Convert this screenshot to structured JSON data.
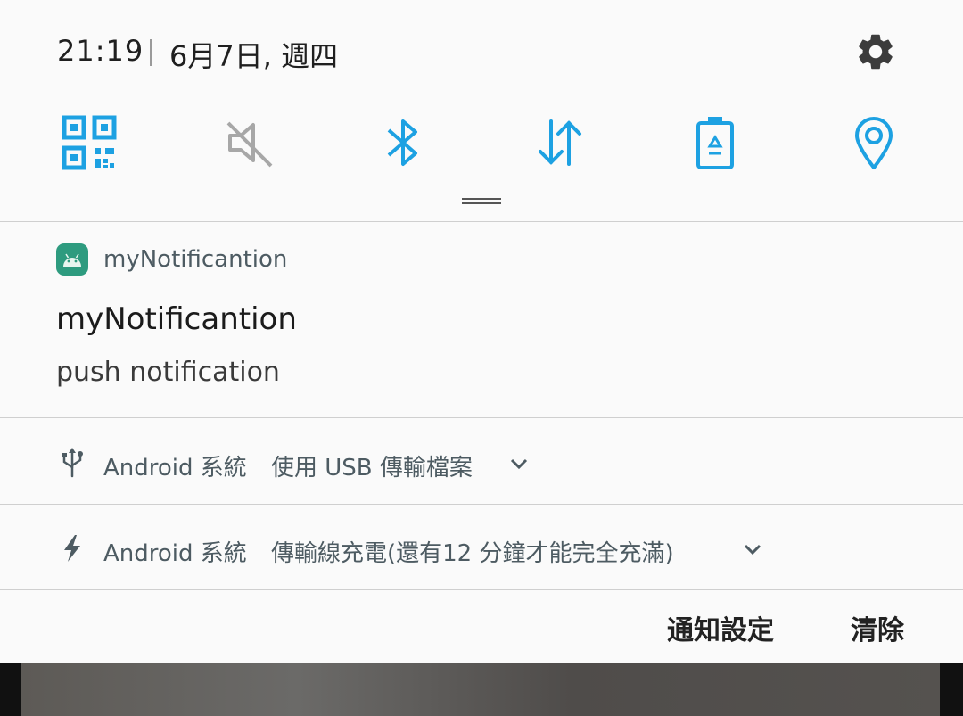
{
  "status": {
    "time": "21:19",
    "date": "6月7日, 週四"
  },
  "quick_settings": [
    {
      "name": "qr-code-icon",
      "color": "#1da1e2",
      "active": true
    },
    {
      "name": "mute-icon",
      "color": "#a7a7a7",
      "active": false
    },
    {
      "name": "bluetooth-icon",
      "color": "#1da1e2",
      "active": true
    },
    {
      "name": "mobile-data-icon",
      "color": "#1da1e2",
      "active": true
    },
    {
      "name": "power-saving-icon",
      "color": "#1da1e2",
      "active": true
    },
    {
      "name": "location-icon",
      "color": "#1da1e2",
      "active": true
    }
  ],
  "notification": {
    "app_name": "myNotificantion",
    "title": "myNotificantion",
    "body": "push notification",
    "app_icon": "android-icon",
    "app_icon_color": "#2e9b7f"
  },
  "system_rows": [
    {
      "icon": "usb-icon",
      "source": "Android 系統",
      "message": "使用 USB 傳輸檔案"
    },
    {
      "icon": "lightning-icon",
      "source": "Android 系統",
      "message": "傳輸線充電(還有12 分鐘才能完全充滿)"
    }
  ],
  "actions": {
    "settings_label": "通知設定",
    "clear_label": "清除"
  },
  "colors": {
    "accent": "#1da1e2",
    "inactive": "#a7a7a7"
  }
}
